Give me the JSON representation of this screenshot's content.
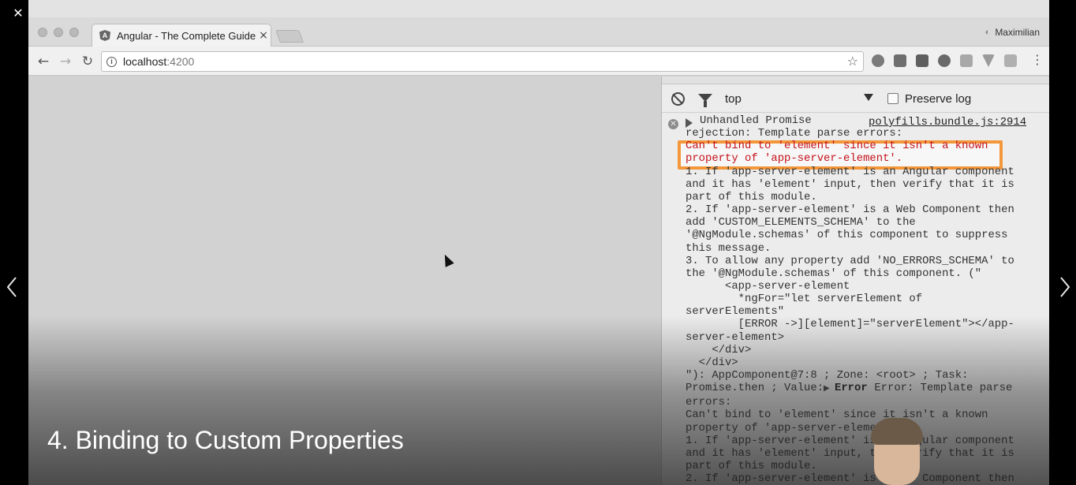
{
  "player": {
    "close_glyph": "✕",
    "restore_glyph": "❐",
    "minimize_glyph": "—",
    "video_title": "4. Binding to Custom Properties"
  },
  "browser": {
    "tab_title": "Angular - The Complete Guide",
    "tab_close": "×",
    "tab_logo": "A",
    "profile_name": "Maximilian",
    "url_host": "localhost",
    "url_port": ":4200",
    "info_glyph": "i",
    "star_glyph": "☆",
    "back_glyph": "←",
    "forward_glyph": "→",
    "reload_glyph": "↻",
    "menu_glyph": "⋮"
  },
  "devtools": {
    "context": "top",
    "preserve_log": "Preserve log",
    "error_source": "polyfills.bundle.js:2914",
    "error_lines": [
      "Unhandled Promise",
      "rejection: Template parse errors:",
      "Can't bind to 'element' since it isn't a known",
      "property of 'app-server-element'.",
      "1. If 'app-server-element' is an Angular component",
      "and it has 'element' input, then verify that it is",
      "part of this module.",
      "2. If 'app-server-element' is a Web Component then",
      "add 'CUSTOM_ELEMENTS_SCHEMA' to the",
      "'@NgModule.schemas' of this component to suppress",
      "this message.",
      "3. To allow any property add 'NO_ERRORS_SCHEMA' to",
      "the '@NgModule.schemas' of this component. (\"",
      "      <app-server-element",
      "        *ngFor=\"let serverElement of",
      "serverElements\"",
      "        [ERROR ->][element]=\"serverElement\"></app-",
      "server-element>",
      "    </div>",
      "  </div>",
      "\"): AppComponent@7:8 ; Zone: <root> ; Task:",
      "Promise.then ; Value: ",
      "errors:",
      "Can't bind to 'element' since it isn't a known",
      "property of 'app-server-element'.",
      "1. If 'app-server-element' is an Angular component",
      "and it has 'element' input, then verify that it is",
      "part of this module.",
      "2. If 'app-server-element' is a Web Component then"
    ],
    "value_error_label": "Error",
    "value_error_text": " Error: Template parse"
  }
}
